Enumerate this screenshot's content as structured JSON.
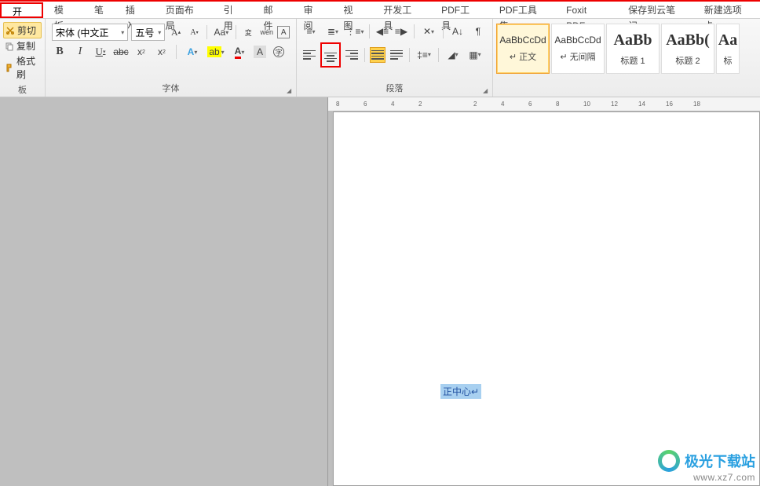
{
  "menu": {
    "tabs": [
      "开始",
      "模板",
      "笔",
      "插入",
      "页面布局",
      "引用",
      "邮件",
      "审阅",
      "视图",
      "开发工具",
      "PDF工具",
      "PDF工具集",
      "Foxit PDF",
      "保存到云笔记",
      "新建选项卡"
    ]
  },
  "clipboard": {
    "cut": "剪切",
    "copy": "复制",
    "format": "格式刷",
    "group": "板"
  },
  "font": {
    "name": "宋体 (中文正",
    "size": "五号",
    "group_label": "字体"
  },
  "paragraph": {
    "group_label": "段落"
  },
  "styles": {
    "items": [
      {
        "preview": "AaBbCcDd",
        "name": "↵ 正文",
        "active": true
      },
      {
        "preview": "AaBbCcDd",
        "name": "↵ 无间隔",
        "active": false
      },
      {
        "preview": "AaBb",
        "name": "标题 1",
        "big": true
      },
      {
        "preview": "AaBb(",
        "name": "标题 2",
        "big": true
      },
      {
        "preview": "Aa",
        "name": "标",
        "big": true
      }
    ]
  },
  "ruler": {
    "marks": [
      "8",
      "6",
      "4",
      "2",
      "",
      "2",
      "4",
      "6",
      "8",
      "10",
      "12",
      "14",
      "16",
      "18"
    ]
  },
  "document": {
    "selected_text": "正中心↵"
  },
  "watermark": {
    "title": "极光下载站",
    "url": "www.xz7.com"
  }
}
